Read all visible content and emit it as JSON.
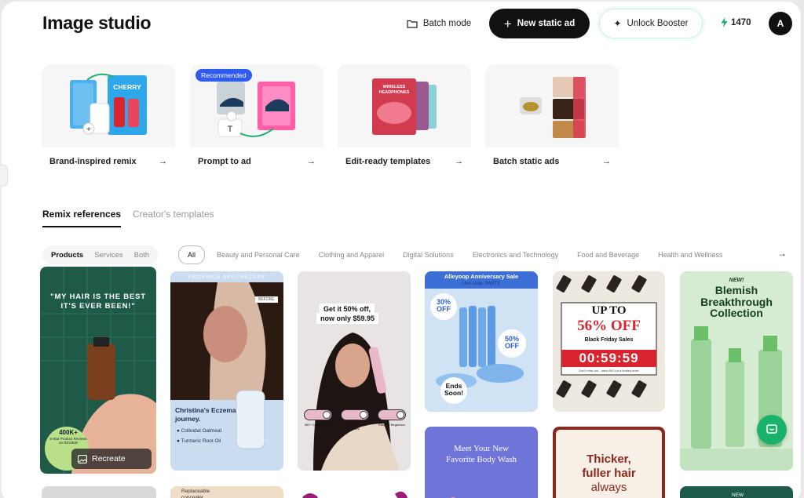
{
  "header": {
    "title": "Image studio",
    "batch_mode": "Batch mode",
    "new_static_ad": "New static ad",
    "unlock_booster": "Unlock Booster",
    "credits": "1470",
    "avatar_initial": "A"
  },
  "cards": [
    {
      "label": "Brand-inspired remix",
      "art_text": "CHERRY",
      "arrow": "→"
    },
    {
      "label": "Prompt to ad",
      "badge": "Recommended",
      "arrow": "→"
    },
    {
      "label": "Edit-ready templates",
      "art_text": "WIRELESS HEADPHONES",
      "arrow": "→"
    },
    {
      "label": "Batch static ads",
      "arrow": "→"
    }
  ],
  "tabs": {
    "remix": "Remix references",
    "creator": "Creator's templates"
  },
  "segments": [
    "Products",
    "Services",
    "Both"
  ],
  "categories": [
    "All",
    "Beauty and Personal Care",
    "Clothing and Apparel",
    "Digital Solutions",
    "Electronics and Technology",
    "Food and Beverage",
    "Health and Wellness"
  ],
  "gallery": {
    "t1": {
      "headline": "\"MY HAIR IS THE BEST IT'S EVER BEEN!\"",
      "badge": "400K+",
      "badge_sub": "5-Star Product Reviews on REVIEW",
      "recreate": "Recreate"
    },
    "t2": {
      "brand": "PROVINCE APOTHECARY",
      "before": "BEFORE",
      "name": "Christina's Eczema journey.",
      "bullet1": "Colloidal Oatmeal",
      "bullet2": "Turmeric Root Oil"
    },
    "t3": {
      "line1": "Get it 50% off,",
      "line2": "now only $59.95",
      "opt1": "360° Cooling Vents",
      "opt2": "Curved Titanium Plates",
      "opt3": "Easy for Beginners"
    },
    "t4": {
      "title": "Alleyoop Anniversary Sale",
      "code": "Use code: PARTY",
      "off1": "30% OFF",
      "off2": "50% OFF",
      "ends": "Ends Soon!"
    },
    "t5": {
      "upto": "UP TO",
      "pct": "56% OFF",
      "sub": "Black Friday Sales",
      "timer": "00:59:59",
      "note": "Don't miss out - save BIG for a limited time!"
    },
    "t6": {
      "new": "NEW!",
      "line1": "Blemish",
      "line2": "Breakthrough",
      "line3": "Collection"
    },
    "t7": {
      "line1": "Meet Your New",
      "line2": "Favorite Body Wash"
    },
    "t8": {
      "line1": "Thicker,",
      "line2": "fuller hair",
      "line3": "always"
    },
    "t9": {
      "text": "Replaceable concealer"
    },
    "t10": {
      "text": "NEW"
    }
  },
  "colors": {
    "accent_green": "#19b26b",
    "primary_black": "#111111",
    "recommended_blue": "#2f5bf0"
  }
}
